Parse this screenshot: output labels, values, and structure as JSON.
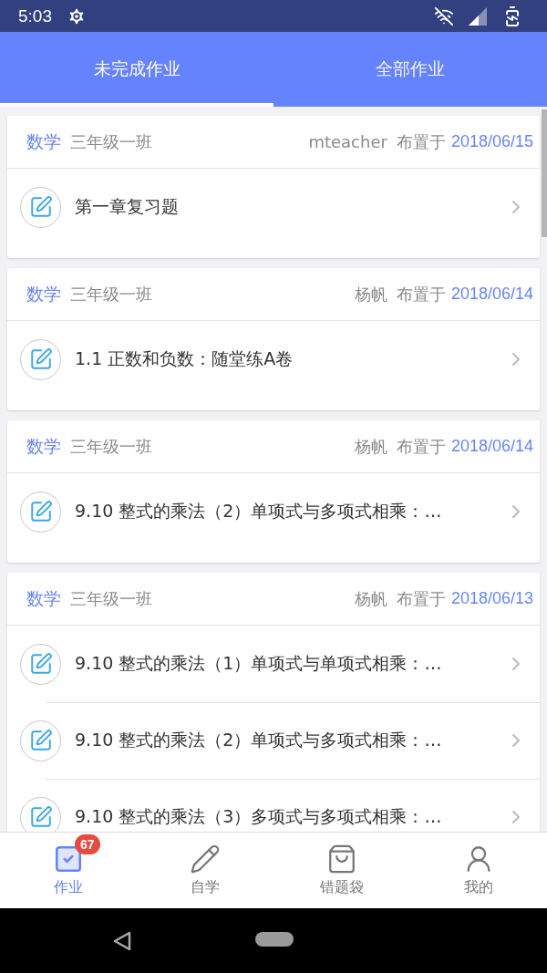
{
  "status_bar": {
    "time": "5:03"
  },
  "tabs": [
    {
      "label": "未完成作业",
      "selected": true
    },
    {
      "label": "全部作业",
      "selected": false
    }
  ],
  "assignments": [
    {
      "subject": "数学",
      "class": "三年级一班",
      "teacher": "mteacher",
      "assigned_label": "布置于",
      "date": "2018/06/15",
      "items": [
        {
          "title": "第一章复习题"
        }
      ]
    },
    {
      "subject": "数学",
      "class": "三年级一班",
      "teacher": "杨帆",
      "assigned_label": "布置于",
      "date": "2018/06/14",
      "items": [
        {
          "title": "1.1 正数和负数：随堂练A卷"
        }
      ]
    },
    {
      "subject": "数学",
      "class": "三年级一班",
      "teacher": "杨帆",
      "assigned_label": "布置于",
      "date": "2018/06/14",
      "items": [
        {
          "title": "9.10 整式的乘法（2）单项式与多项式相乘：…"
        }
      ]
    },
    {
      "subject": "数学",
      "class": "三年级一班",
      "teacher": "杨帆",
      "assigned_label": "布置于",
      "date": "2018/06/13",
      "items": [
        {
          "title": "9.10 整式的乘法（1）单项式与单项式相乘：…"
        },
        {
          "title": "9.10 整式的乘法（2）单项式与多项式相乘：…"
        },
        {
          "title": "9.10 整式的乘法（3）多项式与多项式相乘：…"
        }
      ]
    }
  ],
  "bottom_nav": [
    {
      "kind": "homework",
      "label": "作业",
      "selected": true,
      "badge": "67"
    },
    {
      "kind": "self-study",
      "label": "自学",
      "selected": false
    },
    {
      "kind": "mistakes",
      "label": "错题袋",
      "selected": false
    },
    {
      "kind": "profile",
      "label": "我的",
      "selected": false
    }
  ]
}
